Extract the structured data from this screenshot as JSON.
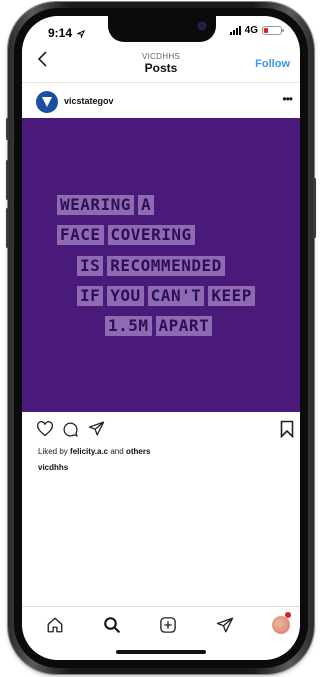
{
  "status_bar": {
    "time": "9:14",
    "network": "4G"
  },
  "nav": {
    "account_label": "VICDHHS",
    "title": "Posts",
    "follow_label": "Follow"
  },
  "post": {
    "account_name": "vicstategov",
    "image_text_lines": [
      [
        "WEARING",
        "A"
      ],
      [
        "FACE",
        "COVERING"
      ],
      [
        "IS",
        "RECOMMENDED"
      ],
      [
        "IF",
        "YOU",
        "CAN'T",
        "KEEP"
      ],
      [
        "1.5M",
        "APART"
      ]
    ],
    "liked_by_prefix": "Liked by",
    "liked_by_user": "felicity.a.c",
    "liked_by_and": "and",
    "liked_by_others": "others",
    "caption_user": "vicdhhs"
  },
  "tab_bar": {
    "items": [
      "home-icon",
      "search-icon",
      "new-post-icon",
      "direct-message-icon",
      "profile-avatar"
    ]
  },
  "colors": {
    "post_background": "#4a1a7a",
    "text_chip": "#8e6ab2",
    "chip_text": "#2e0f55",
    "follow": "#3897f0"
  }
}
